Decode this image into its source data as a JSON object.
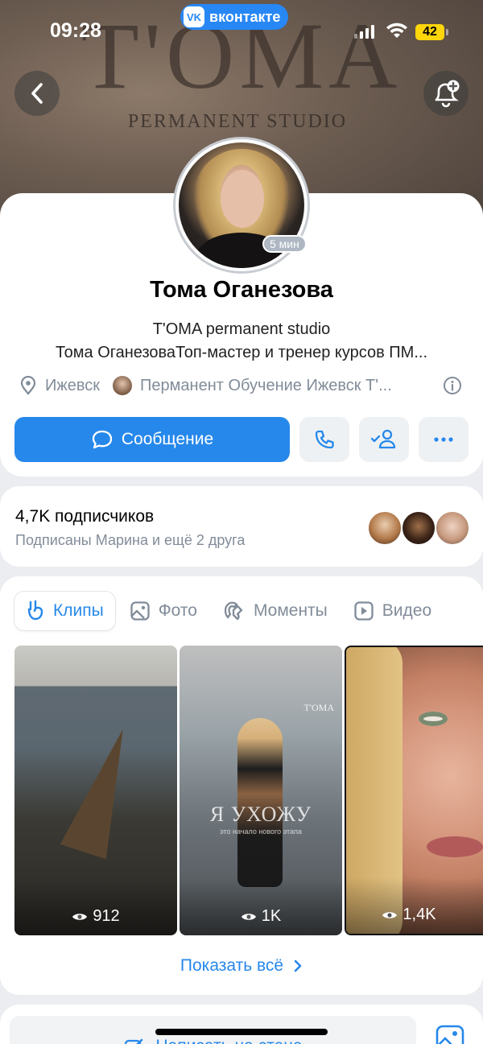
{
  "status_bar": {
    "time": "09:28",
    "battery": "42",
    "app_pill": "вконтакте",
    "app_logo": "VK"
  },
  "cover": {
    "brand": "T'OMA",
    "subtitle": "PERMANENT STUDIO"
  },
  "profile": {
    "name": "Тома Оганезова",
    "online_badge": "5 мин",
    "bio_line1": "T'OMA permanent studio",
    "bio_line2": "Тома ОганезоваТоп-мастер и тренер курсов ПМ...",
    "city": "Ижевск",
    "group": "Перманент Обучение Ижевск Т'..."
  },
  "actions": {
    "message_label": "Сообщение"
  },
  "followers": {
    "title": "4,7K подписчиков",
    "subtitle": "Подписаны Марина и ещё 2 друга"
  },
  "tabs": [
    {
      "label": "Клипы",
      "icon": "clips-icon",
      "active": true
    },
    {
      "label": "Фото",
      "icon": "photo-icon"
    },
    {
      "label": "Моменты",
      "icon": "moments-icon"
    },
    {
      "label": "Видео",
      "icon": "video-icon"
    }
  ],
  "clips": [
    {
      "views": "912"
    },
    {
      "views": "1K",
      "overlay_title": "Я УХОЖУ",
      "overlay_sub": "это начало нового этапа",
      "brand": "T'OMA"
    },
    {
      "views": "1,4K"
    }
  ],
  "show_all": "Показать всё",
  "wall": {
    "write_label": "Написать на стене"
  },
  "colors": {
    "accent": "#2688eb",
    "secondary_text": "#818c99",
    "background": "#ebedf0"
  }
}
